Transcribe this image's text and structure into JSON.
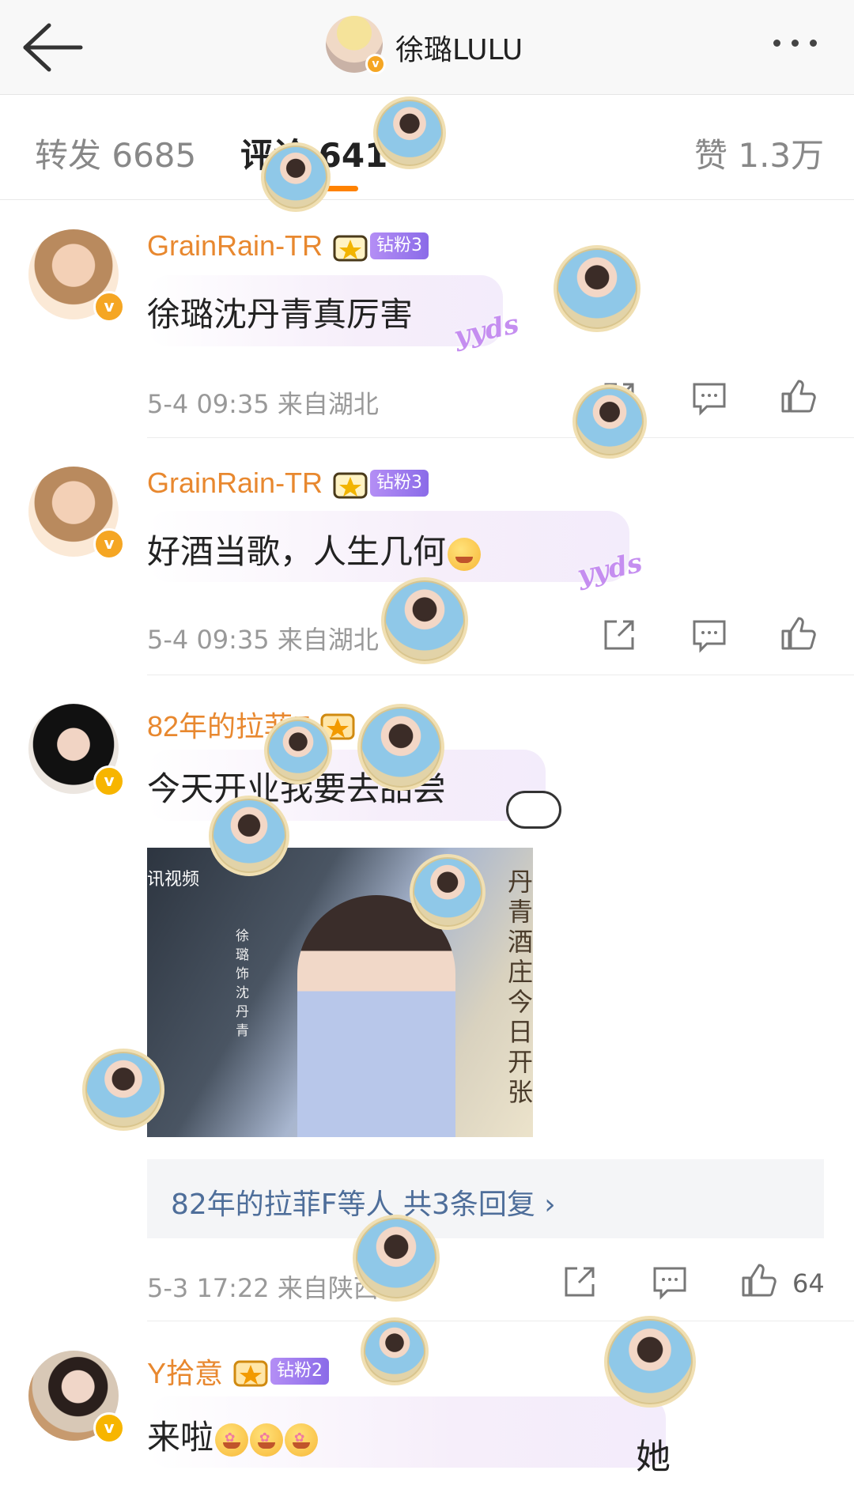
{
  "header": {
    "title": "徐璐LULU",
    "back_icon": "arrow-left-icon",
    "more_icon": "more-horizontal-icon"
  },
  "tabs": [
    {
      "label": "转发 6685"
    },
    {
      "label": "评论 641"
    },
    {
      "label": "赞 1.3万"
    }
  ],
  "accent_color": "#ff8200",
  "comments": [
    {
      "username": "GrainRain-TR",
      "fan_badge": "钻粉3",
      "text": "徐璐沈丹青真厉害",
      "deco": "yyds",
      "meta": "5-4 09:35 来自湖北"
    },
    {
      "username": "GrainRain-TR",
      "fan_badge": "钻粉3",
      "text": "好酒当歌，人生几何",
      "deco": "yyds",
      "meta": "5-4 09:35 来自湖北"
    },
    {
      "username": "82年的拉菲F",
      "text": "今天开业我要去品尝",
      "image": {
        "corner_text": "讯视频",
        "vertical_title": "丹青酒庄今日开张",
        "vertical_name": "徐璐饰沈丹青"
      },
      "replies": "82年的拉菲F等人  共3条回复 ›",
      "meta": "5-3 17:22 来自陕西",
      "like_count": "64"
    },
    {
      "username": "Y拾意",
      "fan_badge": "钻粉2",
      "text": "来啦"
    }
  ],
  "watermark": "她"
}
